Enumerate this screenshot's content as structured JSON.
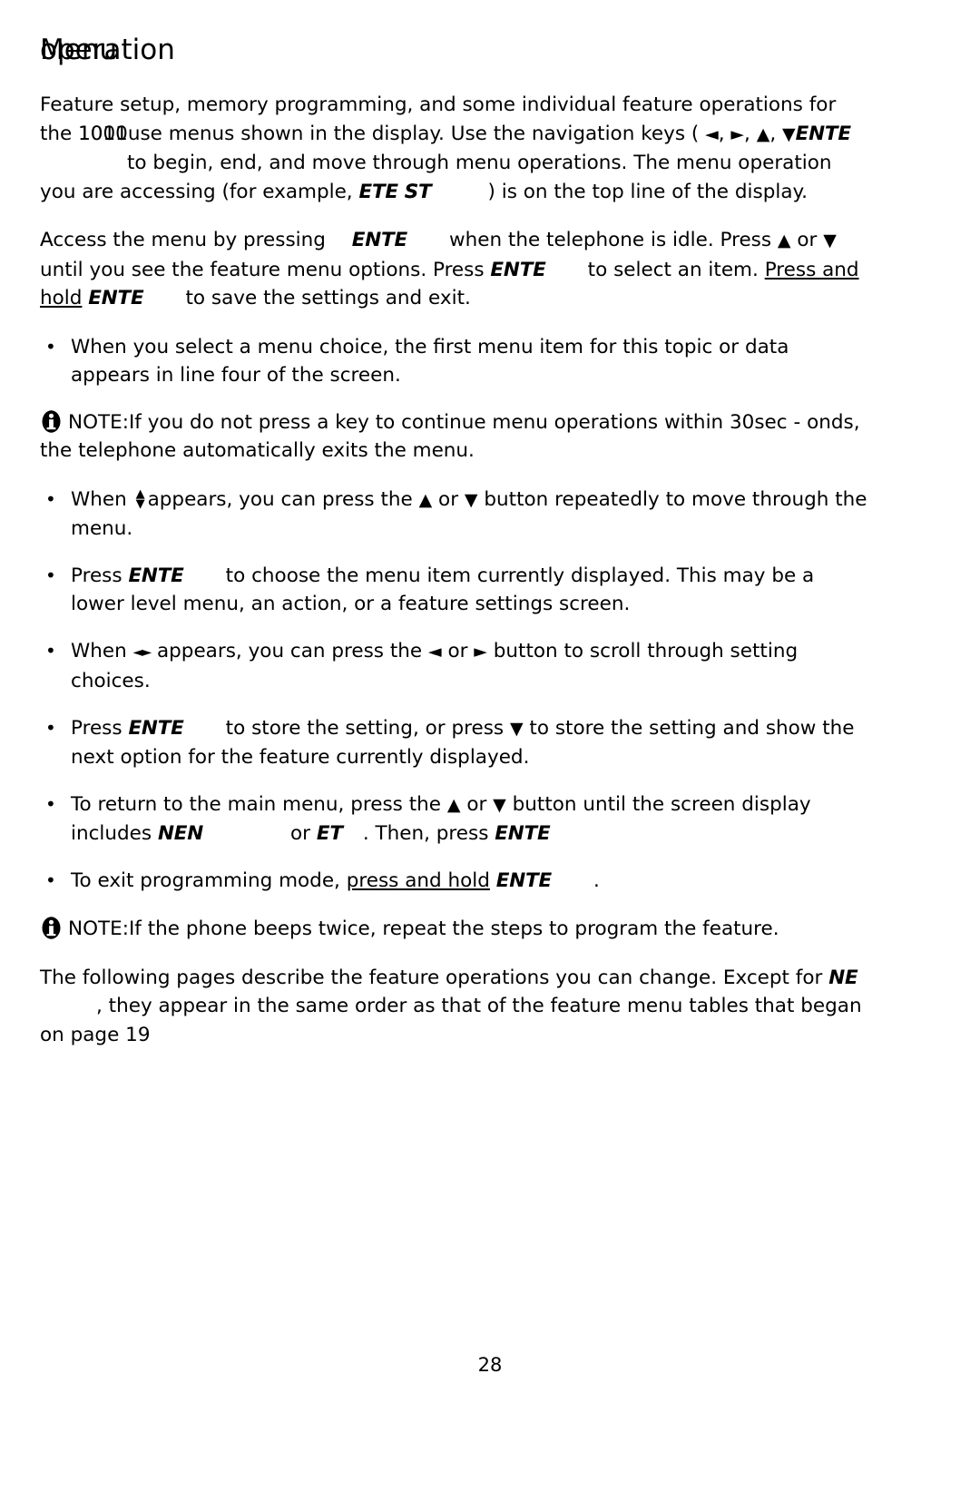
{
  "document": {
    "page_number": "28",
    "title_primary": "Menu",
    "title_secondary": "operation"
  },
  "intro": {
    "line_a": "Feature setup, memory programming, and some individual feature operations",
    "line_b_pre": "for the ",
    "line_b_models_front": "1001",
    "line_b_models_back": "1010",
    "line_b_post": "use menus shown in the display. Use the navigation",
    "line_c_pre": "keys ( ",
    "arrow_left": "◄",
    "arrow_right": "►",
    "arrow_up": "▲",
    "arrow_down": "▼",
    "enter_key_label": "ENTE",
    "line_c_post": "to begin, end, and move through menu",
    "line_d": "operations. The menu operation you are accessing (for example, ",
    "example_key_1": "ETE",
    "example_key_2": "ST",
    "line_e": ") is on the top line of the display."
  },
  "access": {
    "part1": "Access the menu by pressing",
    "key1": "ENTE",
    "part2": "when the telephone is idle. Press",
    "part3": "or",
    "part4": "until you see the feature menu options. Press",
    "key2": "ENTE",
    "part5": "to select an item.",
    "underlined_part": "Press and hold",
    "key3": "ENTE",
    "part6": "to save the settings and exit."
  },
  "bullets": {
    "b1": "When you select a menu choice, the first menu item for this topic or data appears in line four of the screen.",
    "b2_pre": "When",
    "b2_post": "appears, you can press the",
    "b2_mid": "or",
    "b2_end": "button repeatedly to move through the menu.",
    "b3_pre": "Press",
    "b3_key": "ENTE",
    "b3_post": "to choose the menu item currently displayed. This may be a lower level menu, an action, or a feature settings screen.",
    "b4_pre": "When",
    "b4_glyph": "◄►",
    "b4_post": "appears, you can press the",
    "b4_mid": "or",
    "b4_end": "button to scroll through setting choices.",
    "b5_pre": "Press",
    "b5_key": "ENTE",
    "b5_post": "to store the setting, or press",
    "b5_end": "to store the setting and show the next option for the feature currently displayed.",
    "b6_pre": "To return to the main menu, press the",
    "b6_mid": "or",
    "b6_post": "button until the screen display includes",
    "b6_key1": "NEN",
    "b6_or": "or",
    "b6_key2": "ET",
    "b6_then": ". Then, press",
    "b6_key3": "ENTE",
    "b7_pre": "To exit programming mode,",
    "b7_underlined": "press and hold",
    "b7_key": "ENTE",
    "b7_end": "."
  },
  "notes": {
    "note_label": "NOTE:",
    "note1_text_a": "If you do not press a key to continue menu operations within 30",
    "note1_text_b": "sec",
    "note1_text_c": "-",
    "note1_text_d": "onds, the telephone automatically exits the menu.",
    "note2_text": "If the phone beeps twice, repeat the steps to program the feature.",
    "info_icon": "info-icon"
  },
  "closing": {
    "line_a": "The following pages describe the feature operations you can change. ",
    "line_a_tail": "Except",
    "line_b_pre": "for",
    "line_b_key": "NE",
    "line_b_post": ", they appear in the same order as that of the feature menu",
    "line_c": "tables that began on page 19"
  },
  "colors": {
    "text": "#000000",
    "background": "#ffffff"
  }
}
